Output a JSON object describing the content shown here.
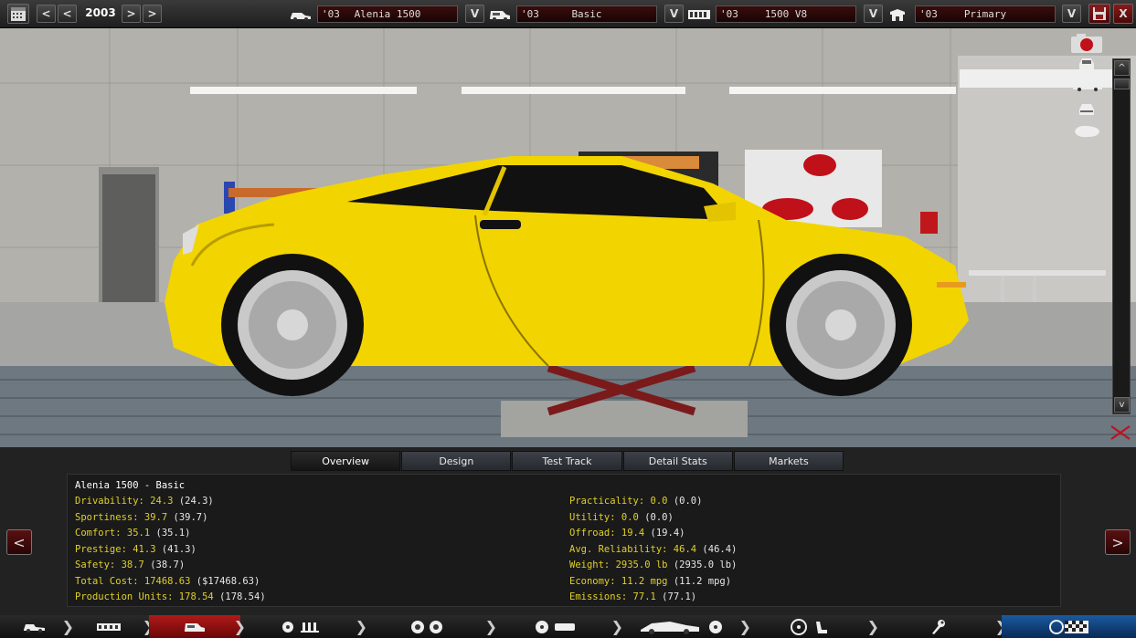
{
  "top_bar": {
    "year": "2003",
    "prev_label": "<",
    "prev2_label": "<",
    "next_label": ">",
    "next2_label": ">",
    "dropdown_label": "V",
    "close_label": "X",
    "selectors": [
      {
        "year": "'03",
        "name": "Alenia 1500",
        "icon": "car-model-icon"
      },
      {
        "year": "'03",
        "name": "Basic",
        "icon": "trim-icon"
      },
      {
        "year": "'03",
        "name": "1500 V8",
        "icon": "engine-icon"
      },
      {
        "year": "'03",
        "name": "Primary",
        "icon": "factory-icon"
      }
    ]
  },
  "scene": {
    "scroll_up": "^",
    "scroll_down": "v",
    "camera_icons": [
      "camera-icon",
      "front-view-icon",
      "side-view-icon",
      "rear-view-icon",
      "top-view-icon"
    ]
  },
  "tabs": [
    {
      "label": "Overview",
      "active": true
    },
    {
      "label": "Design",
      "active": false
    },
    {
      "label": "Test Track",
      "active": false
    },
    {
      "label": "Detail Stats",
      "active": false
    },
    {
      "label": "Markets",
      "active": false
    }
  ],
  "stats": {
    "title": "Alenia 1500 - Basic",
    "left": [
      {
        "label": "Drivability:",
        "value": "24.3",
        "paren": "(24.3)"
      },
      {
        "label": "Sportiness:",
        "value": "39.7",
        "paren": "(39.7)"
      },
      {
        "label": "Comfort:",
        "value": "35.1",
        "paren": "(35.1)"
      },
      {
        "label": "Prestige:",
        "value": "41.3",
        "paren": "(41.3)"
      },
      {
        "label": "Safety:",
        "value": "38.7",
        "paren": "(38.7)"
      },
      {
        "label": "Total Cost:",
        "value": "17468.63",
        "paren": "($17468.63)"
      },
      {
        "label": "Production Units:",
        "value": "178.54",
        "paren": "(178.54)"
      }
    ],
    "right": [
      {
        "label": "Practicality:",
        "value": "0.0",
        "paren": "(0.0)"
      },
      {
        "label": "Utility:",
        "value": "0.0",
        "paren": "(0.0)"
      },
      {
        "label": "Offroad:",
        "value": "19.4",
        "paren": "(19.4)"
      },
      {
        "label": "Avg. Reliability:",
        "value": "46.4",
        "paren": "(46.4)"
      },
      {
        "label": "Weight:",
        "value": "2935.0 lb",
        "paren": "(2935.0 lb)"
      },
      {
        "label": "Economy:",
        "value": "11.2 mpg",
        "paren": "(11.2 mpg)"
      },
      {
        "label": "Emissions:",
        "value": "77.1",
        "paren": "(77.1)"
      }
    ]
  },
  "side_buttons": {
    "left": "<",
    "right": ">"
  },
  "nav": [
    {
      "name": "nav-vehicle",
      "icon": "truck-icon",
      "active": false
    },
    {
      "name": "nav-chassis",
      "icon": "chassis-icon",
      "active": false
    },
    {
      "name": "nav-models",
      "icon": "car-models-icon",
      "active": true
    },
    {
      "name": "nav-engine",
      "icon": "engine-cylinders-icon",
      "active": false
    },
    {
      "name": "nav-gearbox",
      "icon": "gears-icon",
      "active": false
    },
    {
      "name": "nav-brakes",
      "icon": "brakes-icon",
      "active": false
    },
    {
      "name": "nav-body",
      "icon": "car-body-icon",
      "active": false
    },
    {
      "name": "nav-interior",
      "icon": "steering-wheel-icon",
      "active": false
    },
    {
      "name": "nav-factory",
      "icon": "wrench-icon",
      "active": false
    },
    {
      "name": "nav-finish",
      "icon": "checkered-flag-icon",
      "active": false
    }
  ]
}
